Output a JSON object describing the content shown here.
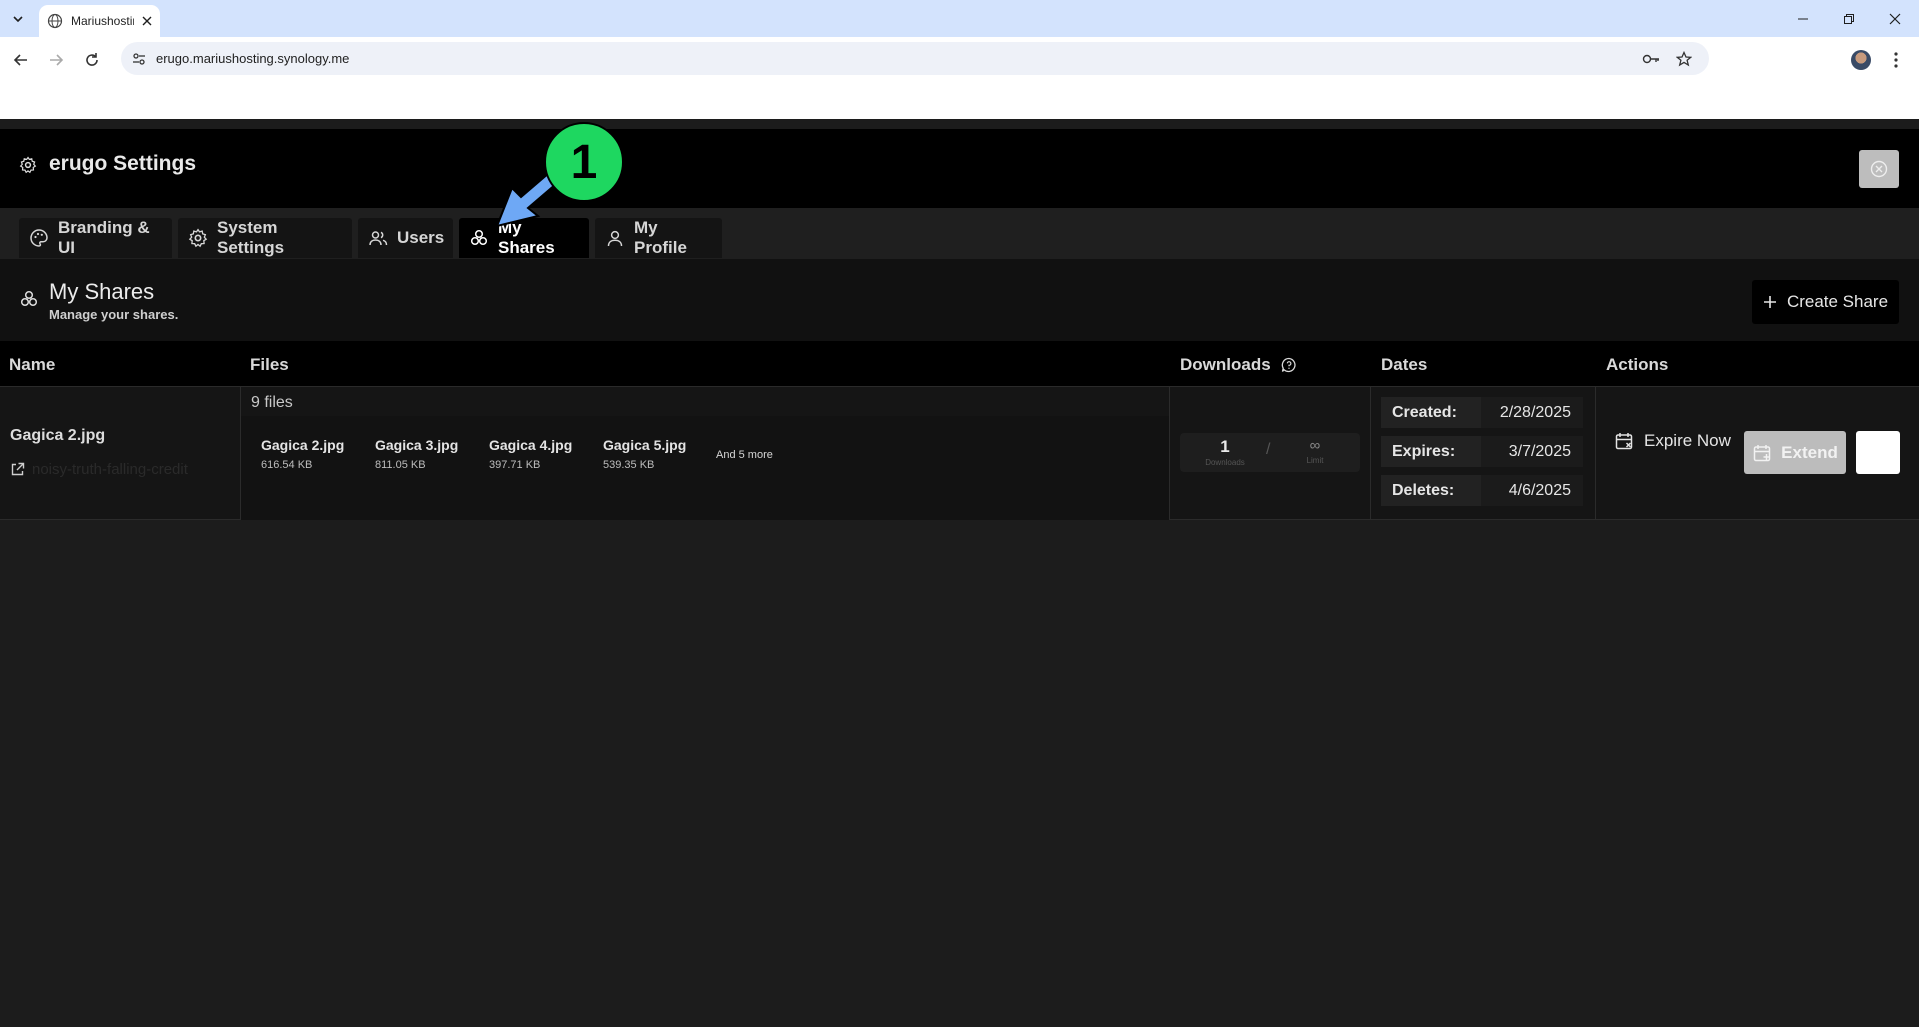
{
  "browser": {
    "tab_title": "Mariushosting",
    "url": "erugo.mariushosting.synology.me"
  },
  "app": {
    "settings_title": "erugo Settings",
    "tabs": [
      {
        "label": "Branding & UI",
        "icon": "palette-icon"
      },
      {
        "label": "System Settings",
        "icon": "gear-icon"
      },
      {
        "label": "Users",
        "icon": "users-icon"
      },
      {
        "label": "My Shares",
        "icon": "shares-icon",
        "active": true
      },
      {
        "label": "My Profile",
        "icon": "user-icon"
      }
    ],
    "section": {
      "title": "My Shares",
      "subtitle": "Manage your shares.",
      "create_label": "Create Share"
    },
    "table": {
      "headers": {
        "name": "Name",
        "files": "Files",
        "downloads": "Downloads",
        "dates": "Dates",
        "actions": "Actions"
      },
      "rows": [
        {
          "name": "Gagica 2.jpg",
          "link": "noisy-truth-falling-credit",
          "files_count": "9 files",
          "files": [
            {
              "name": "Gagica 2.jpg",
              "size": "616.54 KB"
            },
            {
              "name": "Gagica 3.jpg",
              "size": "811.05 KB"
            },
            {
              "name": "Gagica 4.jpg",
              "size": "397.71 KB"
            },
            {
              "name": "Gagica 5.jpg",
              "size": "539.35 KB"
            }
          ],
          "more": "And 5 more",
          "downloads": {
            "value": "1",
            "label": "Downloads",
            "separator": "/",
            "limit": "∞",
            "limit_label": "Limit"
          },
          "dates": [
            {
              "label": "Created:",
              "value": "2/28/2025"
            },
            {
              "label": "Expires:",
              "value": "3/7/2025"
            },
            {
              "label": "Deletes:",
              "value": "4/6/2025"
            }
          ],
          "actions": {
            "expire": "Expire Now",
            "extend": "Extend"
          }
        }
      ]
    }
  },
  "annotation": {
    "number": "1",
    "color": "#1ed760",
    "arrow_color": "#6ea8f5"
  }
}
